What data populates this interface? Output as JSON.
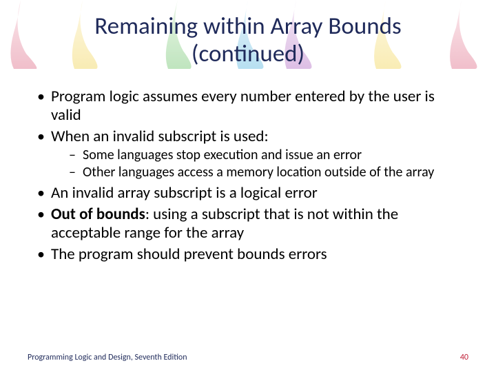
{
  "title_line1": "Remaining within Array Bounds",
  "title_line2": "(continued)",
  "bullets": {
    "b1": "Program logic assumes every number entered by the user is valid",
    "b2": "When an invalid subscript is used:",
    "b2_sub1": "Some languages stop execution and issue an error",
    "b2_sub2": "Other languages access a memory location outside of the array",
    "b3": "An invalid array subscript is a logical error",
    "b4_bold": "Out of bounds",
    "b4_rest": ": using a subscript that is not within the acceptable range for the array",
    "b5": "The program should prevent bounds errors"
  },
  "footer": {
    "book": "Programming Logic and Design, Seventh Edition",
    "page": "40"
  }
}
